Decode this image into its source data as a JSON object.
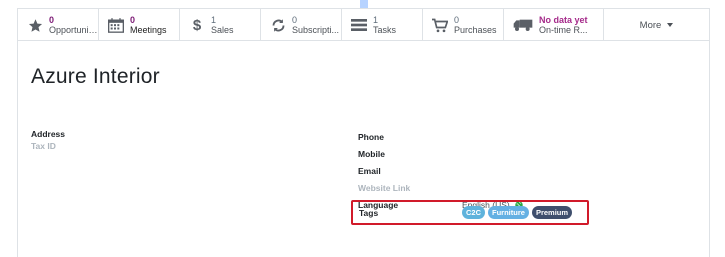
{
  "stat_buttons": [
    {
      "value": "0",
      "label": "Opportunit...",
      "icon": "star-icon"
    },
    {
      "value": "0",
      "label": "Meetings",
      "icon": "calendar-icon"
    },
    {
      "value": "1",
      "label": "Sales",
      "icon": "dollar-icon"
    },
    {
      "value": "0",
      "label": "Subscripti...",
      "icon": "refresh-icon"
    },
    {
      "value": "1",
      "label": "Tasks",
      "icon": "tasks-icon"
    },
    {
      "value": "0",
      "label": "Purchases",
      "icon": "cart-icon"
    },
    {
      "value": "No data yet",
      "label": "On-time R...",
      "icon": "truck-icon"
    }
  ],
  "more_label": "More",
  "partner_name": "Azure Interior",
  "left_fields": {
    "address_label": "Address",
    "tax_id_label": "Tax ID"
  },
  "right_fields": {
    "phone_label": "Phone",
    "mobile_label": "Mobile",
    "email_label": "Email",
    "website_label": "Website Link",
    "language_label": "Language",
    "language_value": "English (US)"
  },
  "tags": {
    "label": "Tags",
    "items": [
      "C2C",
      "Furniture",
      "Premium"
    ]
  },
  "colors": {
    "highlight_border": "#d11a2a",
    "tag_c2c": "#5fb3dc",
    "tag_furniture": "#64b0e3",
    "tag_premium": "#3f4f6d"
  }
}
